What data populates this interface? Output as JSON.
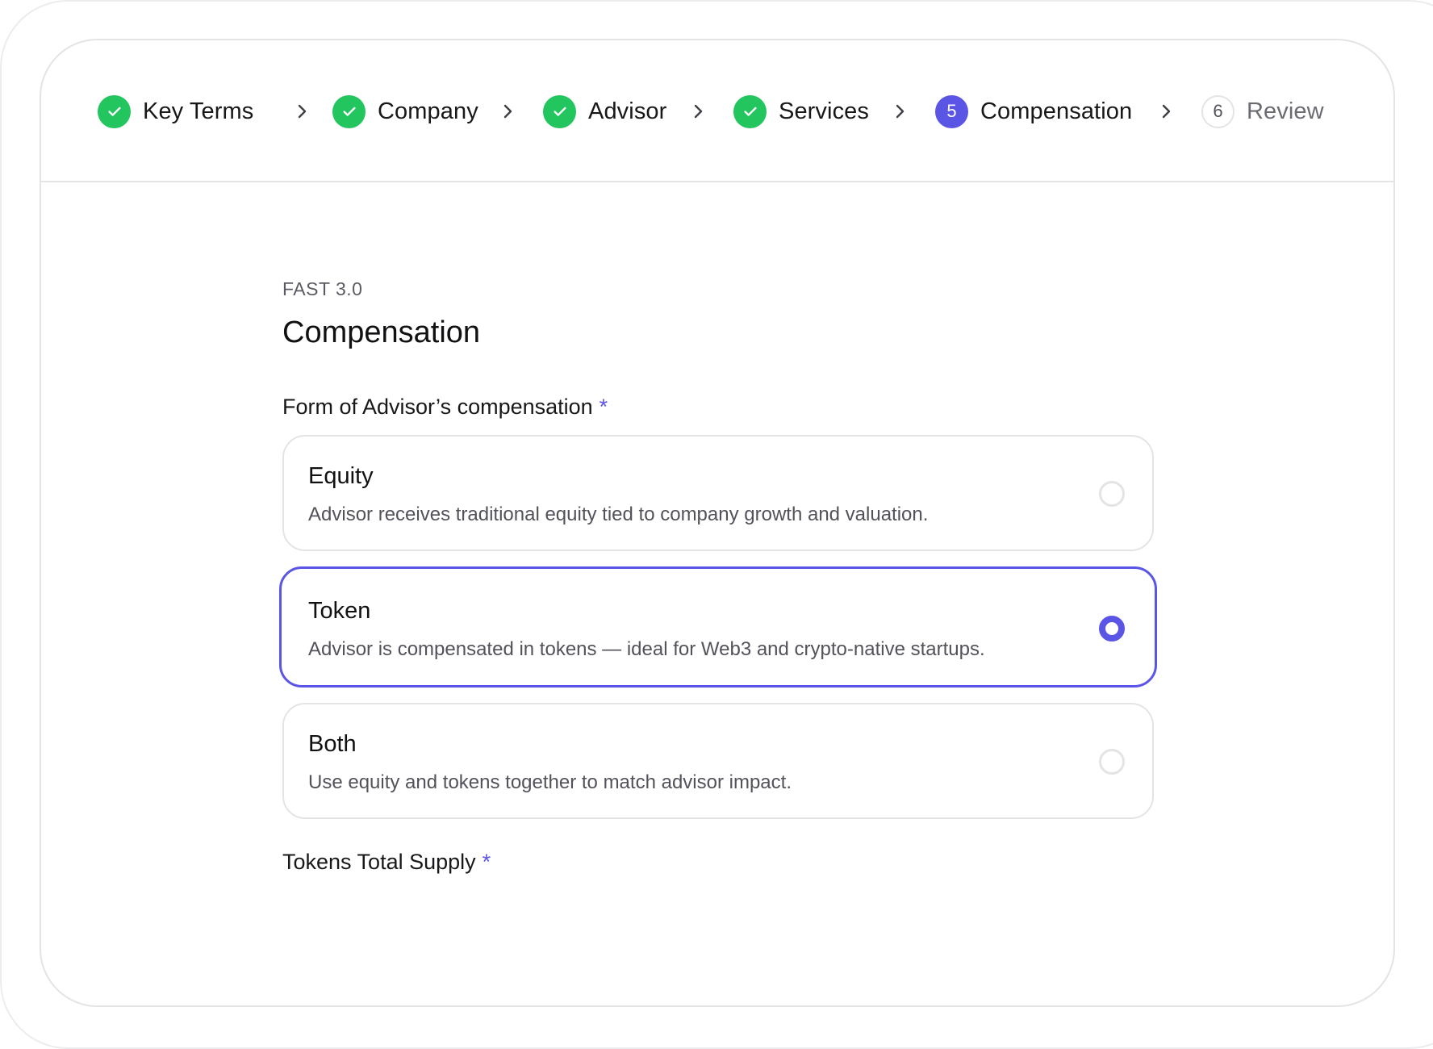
{
  "stepper": {
    "steps": [
      {
        "label": "Key Terms",
        "state": "done"
      },
      {
        "label": "Company",
        "state": "done"
      },
      {
        "label": "Advisor",
        "state": "done"
      },
      {
        "label": "Services",
        "state": "done"
      },
      {
        "label": "Compensation",
        "state": "current",
        "number": "5"
      },
      {
        "label": "Review",
        "state": "upcoming",
        "number": "6"
      }
    ]
  },
  "form": {
    "eyebrow": "FAST 3.0",
    "title": "Compensation",
    "compensation_label": "Form of Advisor’s compensation",
    "required_marker": "*",
    "options": [
      {
        "title": "Equity",
        "description": "Advisor receives traditional equity tied to company growth and valuation.",
        "selected": false
      },
      {
        "title": "Token",
        "description": "Advisor is compensated in tokens — ideal for Web3 and crypto-native startups.",
        "selected": true
      },
      {
        "title": "Both",
        "description": "Use equity and tokens together to match advisor impact.",
        "selected": false
      }
    ],
    "token_supply_label": "Tokens Total Supply"
  },
  "colors": {
    "accent": "#5b55e6",
    "success": "#22c55e",
    "border": "#e4e4e7"
  }
}
